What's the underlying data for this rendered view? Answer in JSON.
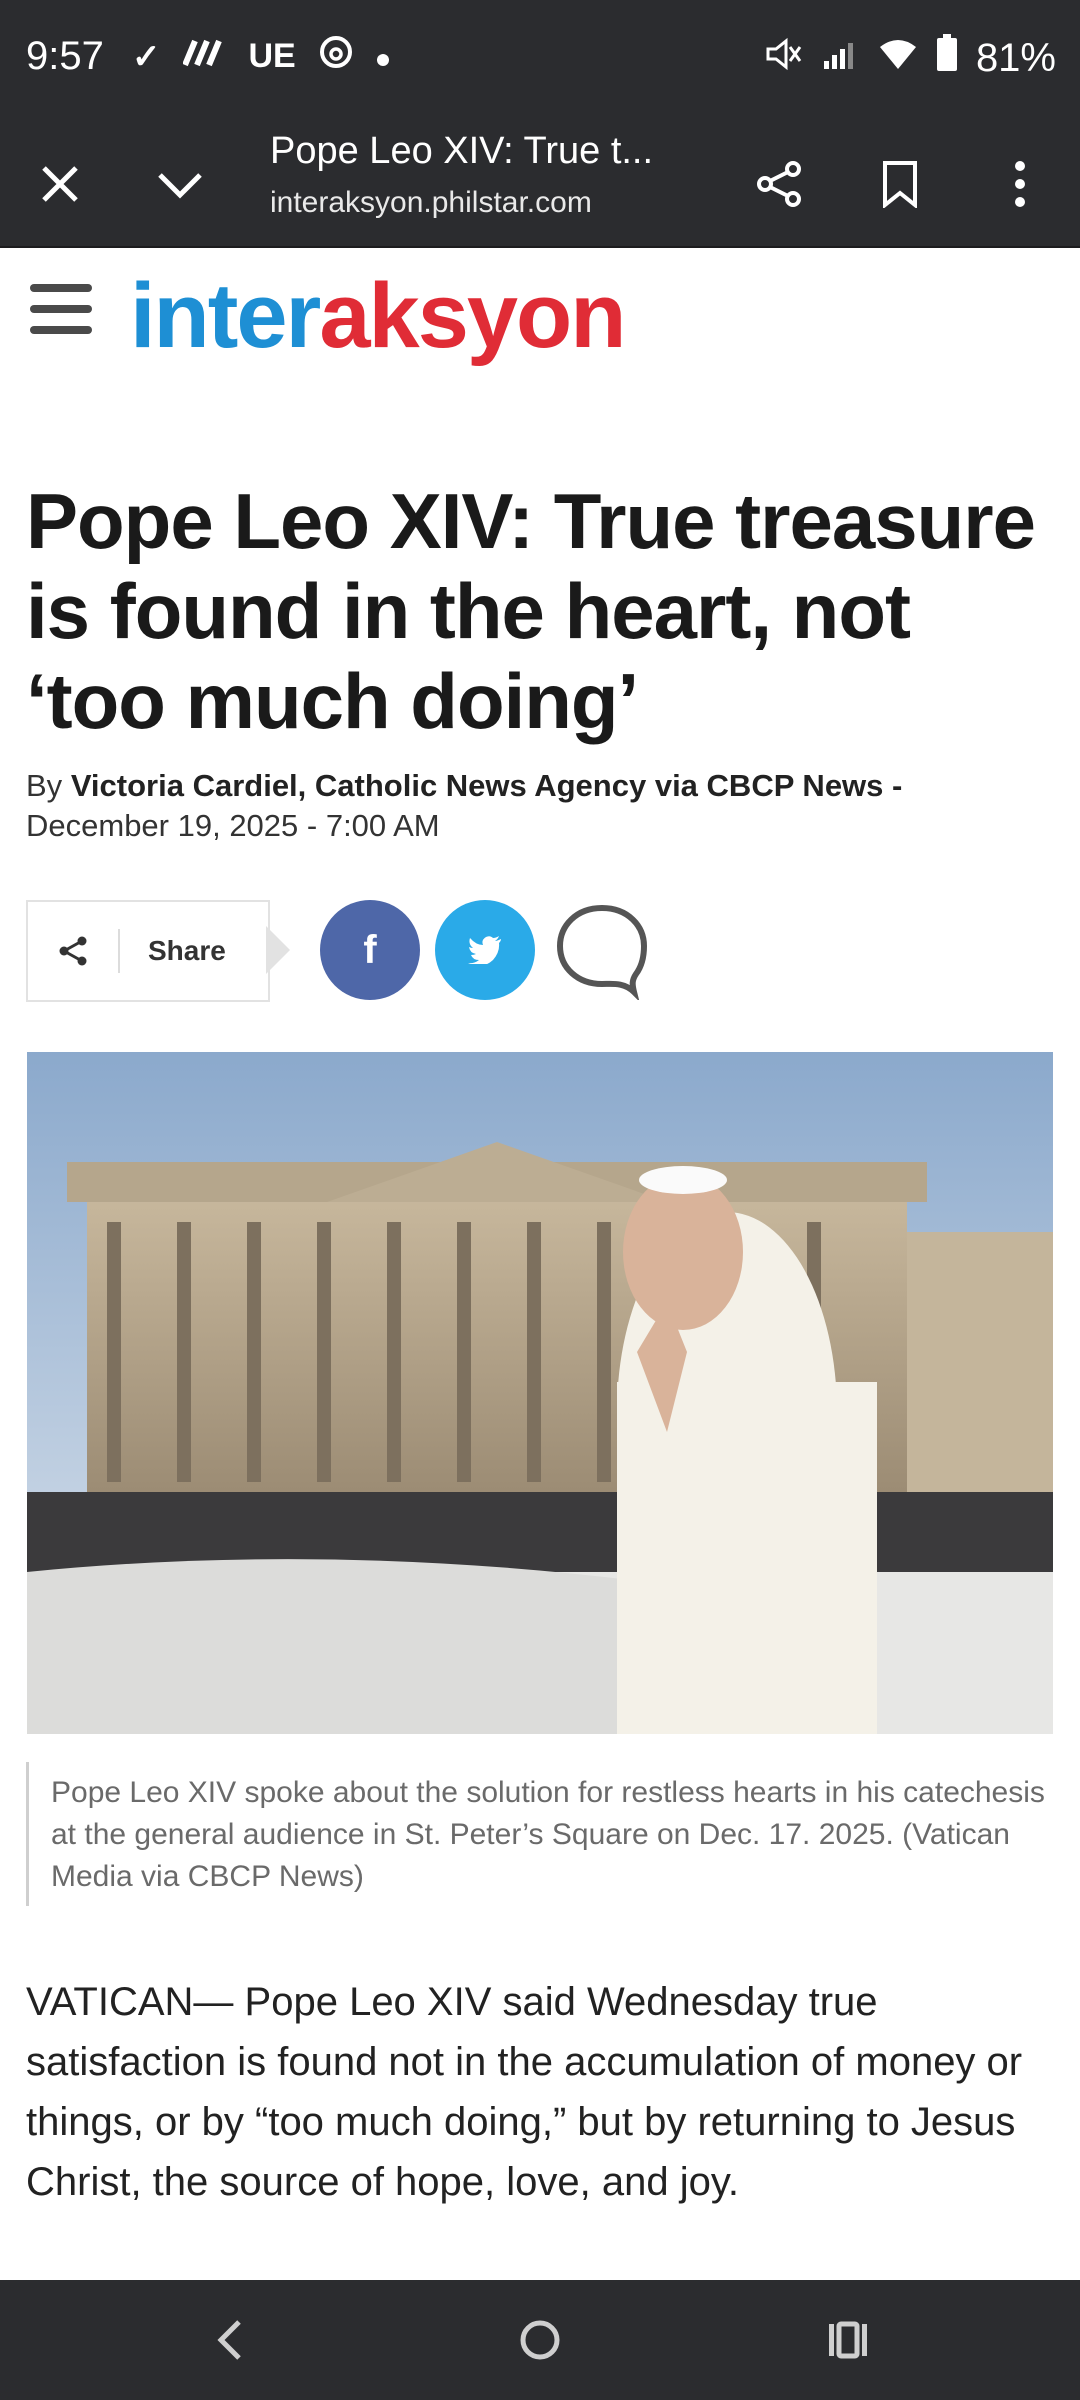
{
  "status_bar": {
    "time": "9:57",
    "app_icons": [
      "check-icon",
      "signal-wave-icon",
      "ue-icon",
      "threads-icon",
      "dot-icon"
    ],
    "ue_label": "UE",
    "battery": "81%"
  },
  "browser": {
    "title": "Pope Leo XIV: True t...",
    "url": "interaksyon.philstar.com"
  },
  "site": {
    "logo_part1": "inter",
    "logo_part2": "aksyon",
    "logo_color1": "#1e8fd4",
    "logo_color2": "#e02c36"
  },
  "article": {
    "headline": "Pope Leo XIV: True treasure is found in the heart, not ‘too much doing’",
    "by_prefix": "By",
    "authors": "Victoria Cardiel, Catholic News Agency via CBCP News -",
    "date": "December 19, 2025 - 7:00 AM",
    "share_label": "Share",
    "facebook_color": "#4e67a8",
    "twitter_color": "#2aaae8",
    "facebook_glyph": "f",
    "caption": "Pope Leo XIV spoke about the solution for restless hearts in his catechesis at the general audience in St. Peter’s Square on Dec. 17. 2025. (Vatican Media via CBCP News)",
    "body": "VATICAN— Pope Leo XIV said Wednesday true satisfaction is found not in the accumulation of money or things, or by “too much doing,” but by returning to Jesus Christ, the source of hope, love, and joy."
  }
}
